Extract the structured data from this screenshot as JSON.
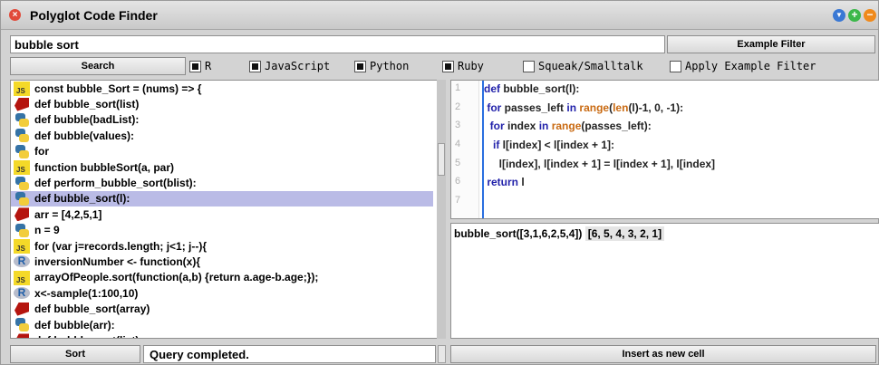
{
  "window": {
    "title": "Polyglot Code Finder",
    "close_glyph": "×",
    "controls": {
      "menu_glyph": "▼",
      "add_glyph": "+",
      "minimize_glyph": "−"
    }
  },
  "query": {
    "value": "bubble sort"
  },
  "buttons": {
    "example_filter": "Example Filter",
    "search": "Search",
    "sort": "Sort",
    "insert": "Insert as new cell"
  },
  "filters": [
    {
      "label": "R",
      "checked": true
    },
    {
      "label": "JavaScript",
      "checked": true
    },
    {
      "label": "Python",
      "checked": true
    },
    {
      "label": "Ruby",
      "checked": true
    },
    {
      "label": "Squeak/Smalltalk",
      "checked": false
    },
    {
      "label": "Apply Example Filter",
      "checked": false
    }
  ],
  "results": [
    {
      "lang": "js",
      "text": "const bubble_Sort = (nums) => {"
    },
    {
      "lang": "ruby",
      "text": "def bubble_sort(list)"
    },
    {
      "lang": "python",
      "text": "def bubble(badList):"
    },
    {
      "lang": "python",
      "text": "def bubble(values):"
    },
    {
      "lang": "python",
      "text": "for"
    },
    {
      "lang": "js",
      "text": "function bubbleSort(a, par)"
    },
    {
      "lang": "python",
      "text": "def perform_bubble_sort(blist):"
    },
    {
      "lang": "python",
      "text": "def bubble_sort(l):",
      "selected": true
    },
    {
      "lang": "ruby",
      "text": "arr = [4,2,5,1]"
    },
    {
      "lang": "python",
      "text": "n = 9"
    },
    {
      "lang": "js",
      "text": "for (var j=records.length; j<1; j--){"
    },
    {
      "lang": "r",
      "text": "inversionNumber <- function(x){"
    },
    {
      "lang": "js",
      "text": "arrayOfPeople.sort(function(a,b) {return a.age-b.age;});"
    },
    {
      "lang": "r",
      "text": "x<-sample(1:100,10)"
    },
    {
      "lang": "ruby",
      "text": "def bubble_sort(array)"
    },
    {
      "lang": "python",
      "text": "def bubble(arr):"
    },
    {
      "lang": "ruby",
      "text": "def bubble_sort(list)"
    }
  ],
  "code": {
    "line_numbers": [
      "1",
      "2",
      "3",
      "4",
      "5",
      "6",
      "7"
    ],
    "lines": [
      [
        {
          "t": "def",
          "c": "kw"
        },
        {
          "t": " bubble_sort(l):",
          "c": ""
        }
      ],
      [
        {
          "t": " for",
          "c": "kw"
        },
        {
          "t": " passes_left ",
          "c": ""
        },
        {
          "t": "in",
          "c": "kw"
        },
        {
          "t": " ",
          "c": ""
        },
        {
          "t": "range",
          "c": "fn"
        },
        {
          "t": "(",
          "c": ""
        },
        {
          "t": "len",
          "c": "fn"
        },
        {
          "t": "(l)-1, 0, -1):",
          "c": ""
        }
      ],
      [
        {
          "t": "  for",
          "c": "kw"
        },
        {
          "t": " index ",
          "c": ""
        },
        {
          "t": "in",
          "c": "kw"
        },
        {
          "t": " ",
          "c": ""
        },
        {
          "t": "range",
          "c": "fn"
        },
        {
          "t": "(passes_left):",
          "c": ""
        }
      ],
      [
        {
          "t": "   if",
          "c": "kw"
        },
        {
          "t": " l[index] < l[index + 1]:",
          "c": ""
        }
      ],
      [
        {
          "t": "     l[index], l[index + 1] = l[index + 1], l[index]",
          "c": ""
        }
      ],
      [
        {
          "t": " return",
          "c": "kw"
        },
        {
          "t": " l",
          "c": ""
        }
      ],
      []
    ]
  },
  "output": {
    "expression": "bubble_sort([3,1,6,2,5,4])",
    "result": "[6, 5, 4, 3, 2, 1]"
  },
  "status": {
    "text": "Query completed."
  },
  "colors": {
    "selection": "#babbe6",
    "keyword": "#2222aa",
    "builtin": "#c96a12",
    "gutter_border": "#2a6fe0"
  },
  "icons": {
    "close": "close-icon",
    "menu": "menu-icon",
    "add": "add-icon",
    "minimize": "minimize-icon",
    "js": "javascript-icon",
    "ruby": "ruby-icon",
    "python": "python-icon",
    "r": "r-icon"
  }
}
